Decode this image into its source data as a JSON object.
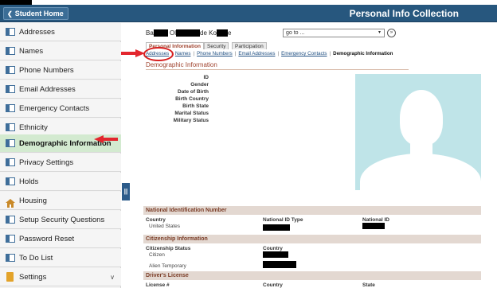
{
  "header": {
    "home_label": "Student Home",
    "title": "Personal Info Collection"
  },
  "sidebar": {
    "items": [
      {
        "label": "Addresses"
      },
      {
        "label": "Names"
      },
      {
        "label": "Phone Numbers"
      },
      {
        "label": "Email Addresses"
      },
      {
        "label": "Emergency Contacts"
      },
      {
        "label": "Ethnicity"
      },
      {
        "label": "Demographic Information"
      },
      {
        "label": "Privacy Settings"
      },
      {
        "label": "Holds"
      },
      {
        "label": "Housing"
      },
      {
        "label": "Setup Security Questions"
      },
      {
        "label": "Password Reset"
      },
      {
        "label": "To Do List"
      },
      {
        "label": "Settings"
      }
    ],
    "active_index": 6
  },
  "name_fragments": [
    "Ba",
    "Ol",
    "de Ko",
    "e"
  ],
  "goto": {
    "value": "go to ..."
  },
  "tabs": [
    "Personal Information",
    "Security",
    "Participation"
  ],
  "subtabs": [
    "Addresses",
    "Names",
    "Phone Numbers",
    "Email Addresses",
    "Emergency Contacts",
    "Demographic Information"
  ],
  "section_title": "Demographic Information",
  "fields": [
    "ID",
    "Gender",
    "Date of Birth",
    "Birth Country",
    "Birth State",
    "Marital Status",
    "Military Status"
  ],
  "national_id": {
    "title": "National Identification Number",
    "col_country": "Country",
    "col_type": "National ID Type",
    "col_id": "National ID",
    "country_value": "United States"
  },
  "citizenship": {
    "title": "Citizenship Information",
    "col_status": "Citizenship Status",
    "col_country": "Country",
    "row1": "Citizen",
    "row2": "Alien Temporary"
  },
  "drivers_license": {
    "title": "Driver's License",
    "col_license": "License #",
    "col_country": "Country",
    "col_state": "State"
  },
  "colors": {
    "header": "#27577e",
    "accent": "#a0442f",
    "arrow": "#e3262e",
    "active_nav": "#d3ead0"
  }
}
